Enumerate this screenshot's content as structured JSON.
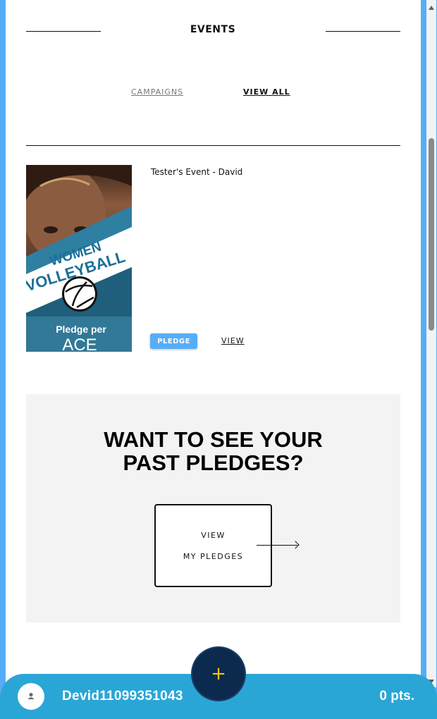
{
  "header": {
    "title": "EVENTS"
  },
  "tabs": [
    {
      "label": "CAMPAIGNS",
      "active": false
    },
    {
      "label": "VIEW ALL",
      "active": true
    }
  ],
  "event": {
    "title": "Tester's Event - David",
    "image_text": {
      "line1": "WOMEN",
      "line2": "VOLLEYBALL",
      "line3": "Pledge per",
      "line4": "ACE"
    },
    "pledge_label": "PLEDGE",
    "view_label": "VIEW"
  },
  "past_pledges": {
    "heading_line1": "WANT TO SEE YOUR",
    "heading_line2": "PAST PLEDGES?",
    "button_line1": "VIEW",
    "button_line2": "MY PLEDGES"
  },
  "bottom_bar": {
    "username": "Devid11099351043",
    "points": "0 pts.",
    "fab_label": "+"
  },
  "colors": {
    "accent": "#56adf7",
    "bottom_bar": "#2aa6d6",
    "fab": "#0c2a4d",
    "fab_plus": "#f5c518"
  }
}
